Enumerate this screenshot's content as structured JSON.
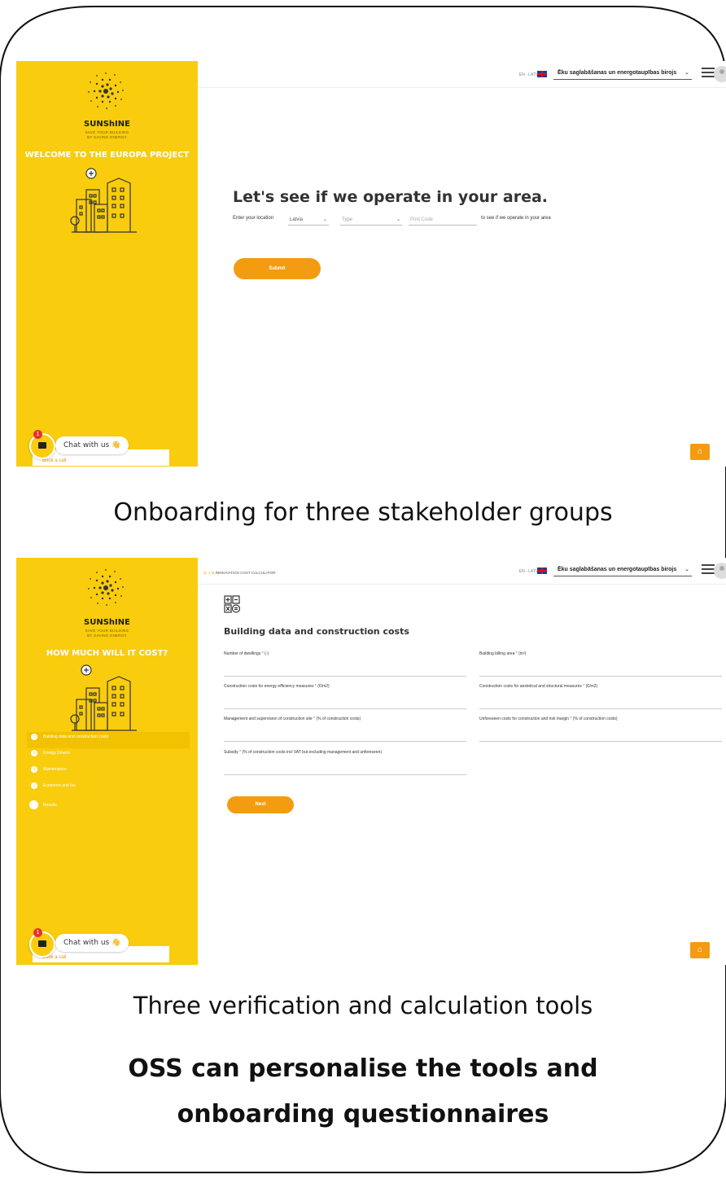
{
  "screen1": {
    "brand_name": "SUNShINE",
    "brand_tag_line1": "SAVE YOUR BUILDING",
    "brand_tag_line2": "BY SAVING ENERGY",
    "welcome": "WELCOME TO THE EUROPA PROJECT",
    "lang": "EN - LATVIA",
    "office": "Ēku saglabāšanas un energotaupības birojs",
    "heading": "Let's see if we operate in your area.",
    "enter_location": "Enter your location",
    "country": "Latvia",
    "type_placeholder": "Type",
    "postcode_placeholder": "Post Code",
    "to_see": "to see if we operate in your area",
    "submit": "Submit",
    "chat": "Chat with us 👋",
    "chat_badge": "1",
    "book": "Book a call"
  },
  "screen2": {
    "brand_name": "SUNShINE",
    "brand_tag_line1": "SAVE YOUR BUILDING",
    "brand_tag_line2": "BY SAVING ENERGY",
    "howmuch": "HOW MUCH WILL IT COST?",
    "step_counter": "Q: 1 /5",
    "calculator_title": "RENOVATION COST CALCULATOR",
    "lang": "EN - LATVIA",
    "office": "Ēku saglabāšanas un energotaupības birojs",
    "section_title": "Building data and construction costs",
    "fields": {
      "dwellings": "Number of dwellings",
      "dwellings_unit": " (-)",
      "billing_area": "Building billing area",
      "billing_area_unit": " (m²)",
      "ee_costs": "Construction costs for energy efficiency measures",
      "ee_costs_unit": " (€/m2)",
      "aesthetic_costs": "Construction costs for aestetical and structural measures",
      "aesthetic_costs_unit": " (€/m2)",
      "management": "Management and supervision of construction site",
      "management_unit": " (% of construction costs)",
      "unforeseen": "Unforeseen costs for construction and risk margin",
      "unforeseen_unit": " (% of construction costs)",
      "subsidy": "Subsidy",
      "subsidy_unit": " (% of construction costs incl VAT but excluding management and unforeseen)",
      "required_mark": " *"
    },
    "steps": [
      {
        "num": "1",
        "label": "Building data and construction costs"
      },
      {
        "num": "2",
        "label": "Energy Drivers"
      },
      {
        "num": "3",
        "label": "Maintenance"
      },
      {
        "num": "4",
        "label": "Economic and tax"
      },
      {
        "num": "",
        "label": "Results"
      }
    ],
    "next": "Next",
    "chat": "Chat with us 👋",
    "chat_badge": "1",
    "book": "Book a call"
  },
  "captions": {
    "onboarding": "Onboarding for three stakeholder groups",
    "tools": "Three verification and calculation tools",
    "oss_line1": "OSS can personalise the tools and",
    "oss_line2": "onboarding questionnaires"
  },
  "colors": {
    "brand_yellow": "#f9cc0e",
    "accent_orange": "#f39c12"
  }
}
